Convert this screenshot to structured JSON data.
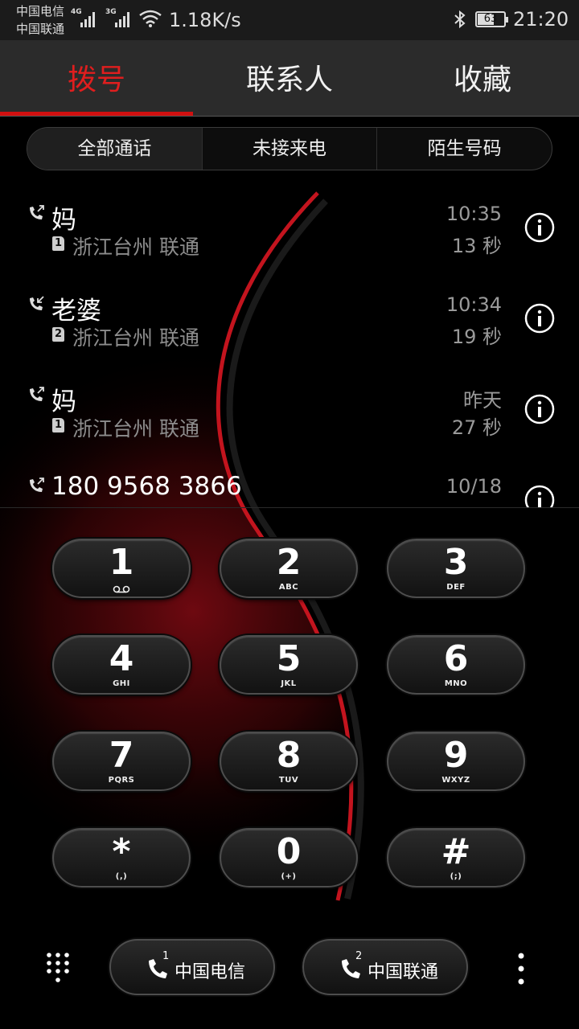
{
  "status_bar": {
    "carrier1": "中国电信",
    "carrier2": "中国联通",
    "sig1_tech": "4G",
    "sig2_tech": "3G",
    "net_speed": "1.18K/s",
    "battery": "63",
    "time": "21:20"
  },
  "tabs": [
    {
      "label": "拨号",
      "active": true
    },
    {
      "label": "联系人",
      "active": false
    },
    {
      "label": "收藏",
      "active": false
    }
  ],
  "filters": [
    {
      "label": "全部通话",
      "active": true
    },
    {
      "label": "未接来电",
      "active": false
    },
    {
      "label": "陌生号码",
      "active": false
    }
  ],
  "calls": [
    {
      "name": "妈",
      "direction": "outgoing",
      "sim": "1",
      "location": "浙江台州 联通",
      "time": "10:35",
      "duration": "13 秒"
    },
    {
      "name": "老婆",
      "direction": "incoming",
      "sim": "2",
      "location": "浙江台州 联通",
      "time": "10:34",
      "duration": "19 秒"
    },
    {
      "name": "妈",
      "direction": "outgoing",
      "sim": "1",
      "location": "浙江台州 联通",
      "time": "昨天",
      "duration": "27 秒"
    },
    {
      "name": "180 9568 3866",
      "direction": "outgoing",
      "sim": "",
      "location": "",
      "time": "10/18",
      "duration": ""
    }
  ],
  "dialpad": [
    {
      "digit": "1",
      "letters": "",
      "voicemail": true
    },
    {
      "digit": "2",
      "letters": "ABC"
    },
    {
      "digit": "3",
      "letters": "DEF"
    },
    {
      "digit": "4",
      "letters": "GHI"
    },
    {
      "digit": "5",
      "letters": "JKL"
    },
    {
      "digit": "6",
      "letters": "MNO"
    },
    {
      "digit": "7",
      "letters": "PQRS"
    },
    {
      "digit": "8",
      "letters": "TUV"
    },
    {
      "digit": "9",
      "letters": "WXYZ"
    },
    {
      "digit": "*",
      "letters": "(,)"
    },
    {
      "digit": "0",
      "letters": "(+)"
    },
    {
      "digit": "#",
      "letters": "(;)"
    }
  ],
  "bottom": {
    "sim1_num": "1",
    "sim1_label": "中国电信",
    "sim2_num": "2",
    "sim2_label": "中国联通"
  },
  "colors": {
    "accent": "#e01e1e",
    "background": "#000000"
  }
}
